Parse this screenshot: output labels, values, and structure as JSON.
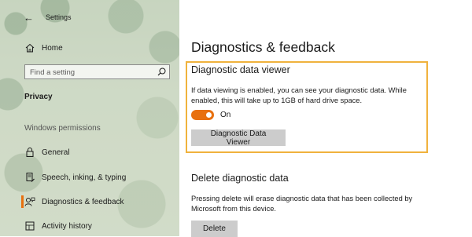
{
  "window": {
    "title": "Settings"
  },
  "sidebar": {
    "home_label": "Home",
    "search_placeholder": "Find a setting",
    "section_header": "Privacy",
    "group_header": "Windows permissions",
    "items": [
      {
        "label": "General",
        "icon": "lock-icon"
      },
      {
        "label": "Speech, inking, & typing",
        "icon": "document-pen-icon"
      },
      {
        "label": "Diagnostics & feedback",
        "icon": "feedback-person-icon",
        "active": true
      },
      {
        "label": "Activity history",
        "icon": "timeline-icon"
      }
    ],
    "accent_color": "#e8700f"
  },
  "main": {
    "page_title": "Diagnostics & feedback",
    "viewer": {
      "title": "Diagnostic data viewer",
      "description": "If data viewing is enabled, you can see your diagnostic data. While enabled, this will take up to 1GB of hard drive space.",
      "toggle_state": "On",
      "toggle_on": true,
      "button_label": "Diagnostic Data Viewer"
    },
    "delete": {
      "title": "Delete diagnostic data",
      "description": "Pressing delete will erase diagnostic data that has been collected by Microsoft from this device.",
      "button_label": "Delete"
    },
    "highlight_color": "#f0b23d"
  }
}
